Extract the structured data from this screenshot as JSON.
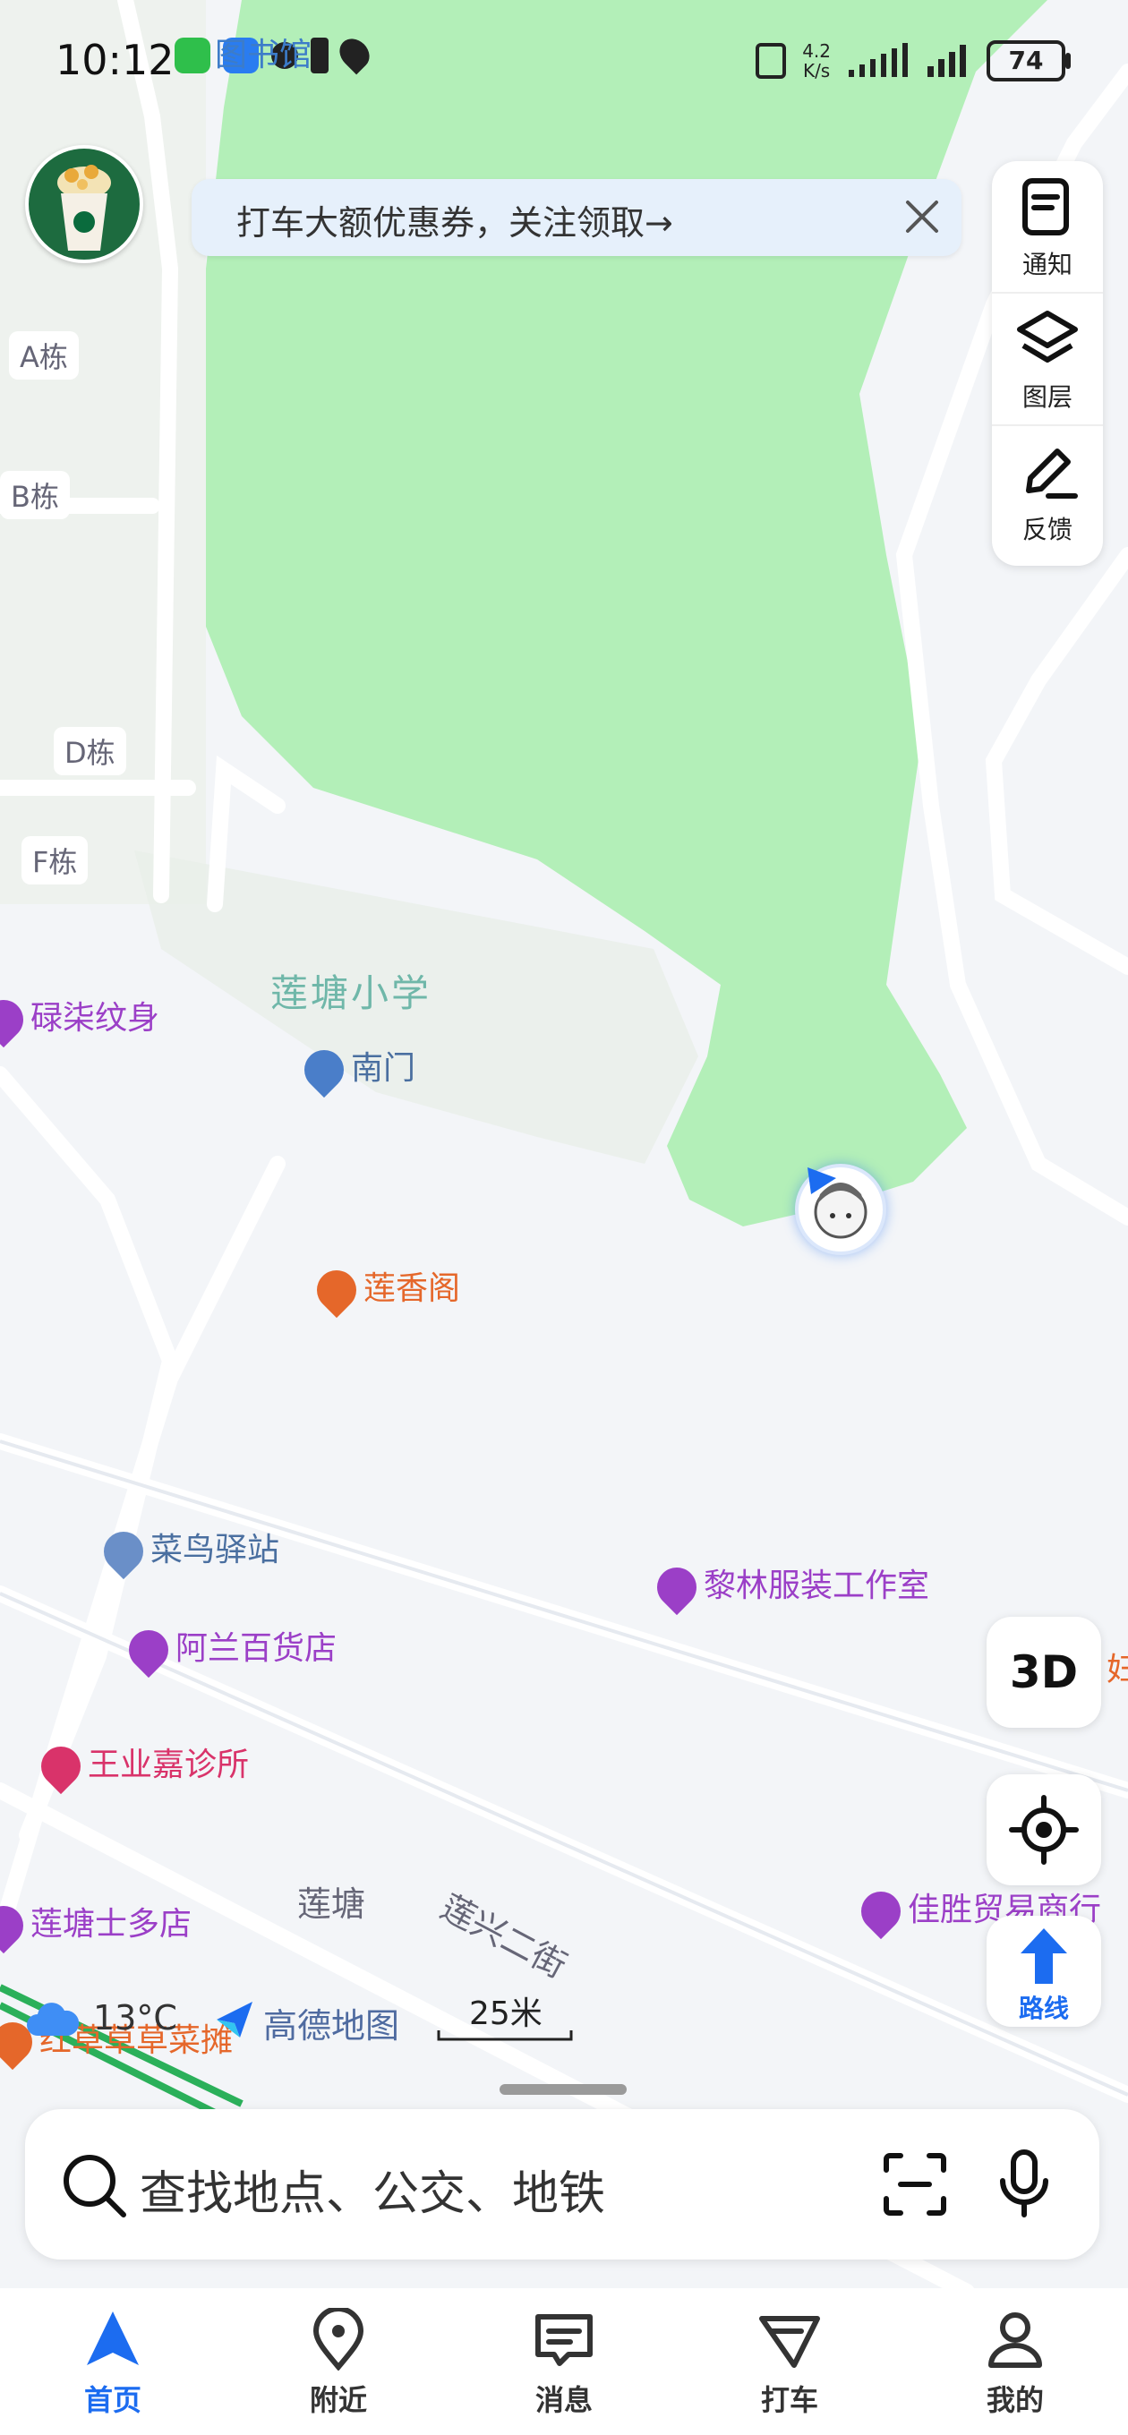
{
  "status_bar": {
    "time": "10:12",
    "net_speed_value": "4.2",
    "net_speed_unit": "K/s",
    "battery": "74"
  },
  "banner": {
    "text": "打车大额优惠券，关注领取→"
  },
  "tools": {
    "notify": "通知",
    "layers": "图层",
    "feedback": "反馈"
  },
  "map": {
    "buildings": [
      "A栋",
      "B栋",
      "D栋",
      "F栋"
    ],
    "top_label": "图书馆",
    "school": "莲塘小学",
    "pois": {
      "tattoo": "碌柒纹身",
      "south_gate": "南门",
      "restaurant": "莲香阁",
      "courier": "菜鸟驿站",
      "clothing": "黎林服装工作室",
      "dept_store": "阿兰百货店",
      "clinic": "王业嘉诊所",
      "store": "莲塘士多店",
      "trade": "佳胜贸易商行",
      "veggie": "红草草草菜摊",
      "edge": "妇"
    },
    "area": "莲塘",
    "street": "莲兴二街",
    "weather": "13°C",
    "brand": "高德地图",
    "scale": "25米"
  },
  "controls": {
    "three_d": "3D",
    "route": "路线"
  },
  "search": {
    "placeholder": "查找地点、公交、地铁"
  },
  "tabbar": [
    {
      "label": "首页",
      "active": true
    },
    {
      "label": "附近"
    },
    {
      "label": "消息"
    },
    {
      "label": "打车"
    },
    {
      "label": "我的"
    }
  ],
  "colors": {
    "accent": "#1c6cf0",
    "park": "#b3efb8",
    "map_bg": "#f3f5f8",
    "poi_purple": "#9b3fc7",
    "poi_orange": "#e5672a",
    "poi_pink": "#d9336a",
    "poi_blue": "#4a7ec9"
  }
}
